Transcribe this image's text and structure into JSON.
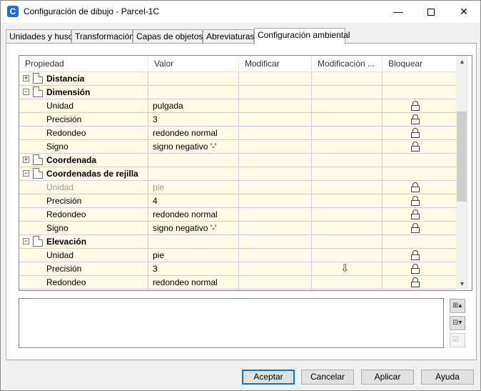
{
  "window": {
    "title": "Configuración de dibujo - Parcel-1C",
    "app_icon": "C",
    "minimize_glyph": "—",
    "close_glyph": "✕"
  },
  "tabs": [
    {
      "label": "Unidades y huso",
      "active": false
    },
    {
      "label": "Transformación",
      "active": false
    },
    {
      "label": "Capas de objetos",
      "active": false
    },
    {
      "label": "Abreviaturas",
      "active": false
    },
    {
      "label": "Configuración ambiental",
      "active": true
    }
  ],
  "grid": {
    "columns": [
      "Propiedad",
      "Valor",
      "Modificar",
      "Modificación ...",
      "Bloquear"
    ],
    "rows": [
      {
        "kind": "group",
        "expander": "+",
        "property": "Distancia",
        "value": "",
        "lock": false,
        "arrow": false
      },
      {
        "kind": "group",
        "expander": "−",
        "property": "Dimensión",
        "value": "",
        "lock": false,
        "arrow": false
      },
      {
        "kind": "child",
        "property": "Unidad",
        "value": "pulgada",
        "lock": true,
        "arrow": false,
        "disabled": false
      },
      {
        "kind": "child",
        "property": "Precisión",
        "value": "3",
        "lock": true,
        "arrow": false,
        "disabled": false
      },
      {
        "kind": "child",
        "property": "Redondeo",
        "value": "redondeo normal",
        "lock": true,
        "arrow": false,
        "disabled": false
      },
      {
        "kind": "child",
        "property": "Signo",
        "value": "signo negativo '-'",
        "lock": true,
        "arrow": false,
        "disabled": false
      },
      {
        "kind": "group",
        "expander": "+",
        "property": "Coordenada",
        "value": "",
        "lock": false,
        "arrow": false
      },
      {
        "kind": "group",
        "expander": "−",
        "property": "Coordenadas de rejilla",
        "value": "",
        "lock": false,
        "arrow": false
      },
      {
        "kind": "child",
        "property": "Unidad",
        "value": "pie",
        "lock": true,
        "arrow": false,
        "disabled": true
      },
      {
        "kind": "child",
        "property": "Precisión",
        "value": "4",
        "lock": true,
        "arrow": false,
        "disabled": false
      },
      {
        "kind": "child",
        "property": "Redondeo",
        "value": "redondeo normal",
        "lock": true,
        "arrow": false,
        "disabled": false
      },
      {
        "kind": "child",
        "property": "Signo",
        "value": "signo negativo '-'",
        "lock": true,
        "arrow": false,
        "disabled": false
      },
      {
        "kind": "group",
        "expander": "−",
        "property": "Elevación",
        "value": "",
        "lock": false,
        "arrow": false
      },
      {
        "kind": "child",
        "property": "Unidad",
        "value": "pie",
        "lock": true,
        "arrow": false,
        "disabled": false
      },
      {
        "kind": "child",
        "property": "Precisión",
        "value": "3",
        "lock": true,
        "arrow": true,
        "disabled": false
      },
      {
        "kind": "child",
        "property": "Redondeo",
        "value": "redondeo normal",
        "lock": true,
        "arrow": false,
        "disabled": false
      }
    ]
  },
  "side_buttons": [
    {
      "name": "expand-all-icon",
      "glyph": "⊞▴",
      "disabled": false
    },
    {
      "name": "collapse-all-icon",
      "glyph": "⊟▾",
      "disabled": false
    },
    {
      "name": "check-edit-icon",
      "glyph": "☑",
      "disabled": true
    }
  ],
  "buttons": {
    "ok": "Aceptar",
    "cancel": "Cancelar",
    "apply": "Aplicar",
    "help": "Ayuda"
  },
  "colors": {
    "row_bg": "#fffbe6",
    "grid_line": "#d8c6e8",
    "default_button_border": "#0078d7"
  }
}
